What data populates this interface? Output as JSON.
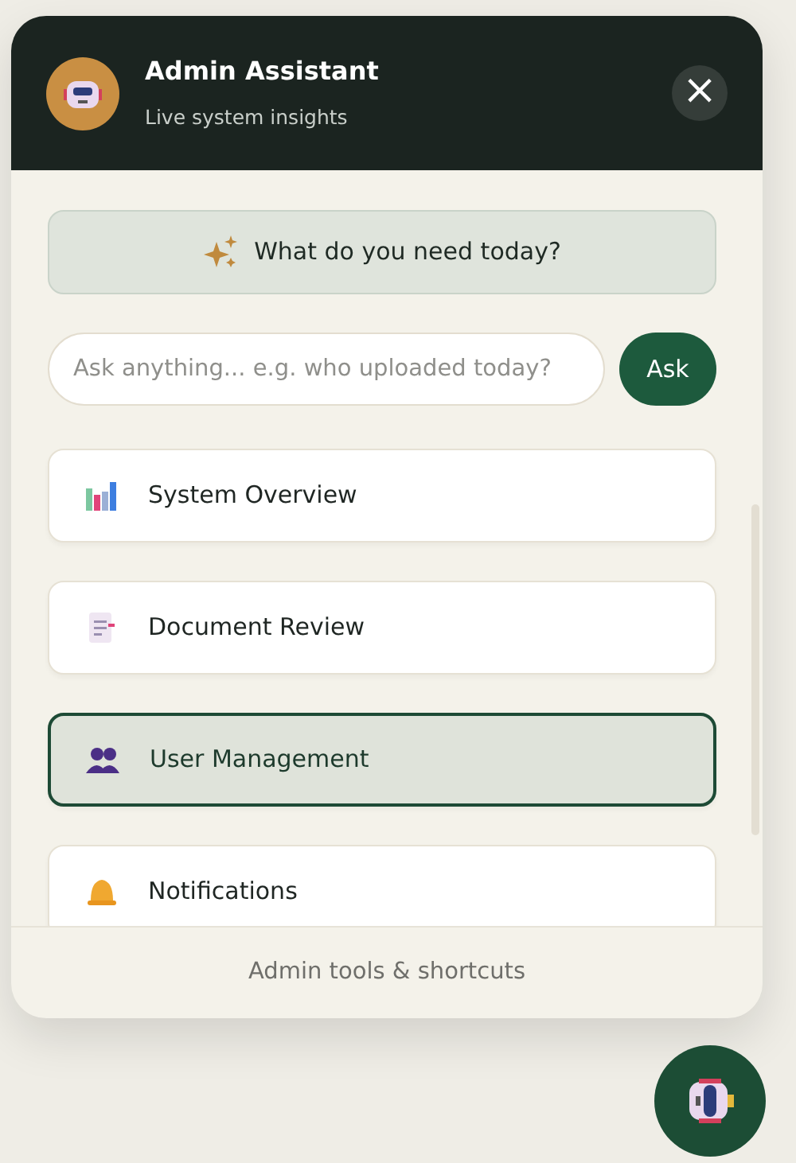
{
  "header": {
    "title": "Admin Assistant",
    "subtitle": "Live system insights",
    "close": "×"
  },
  "prompt": {
    "text": "What do you need today?"
  },
  "ask": {
    "placeholder": "Ask anything... e.g. who uploaded today?",
    "button": "Ask"
  },
  "menu": [
    {
      "label": "System Overview",
      "selected": false
    },
    {
      "label": "Document Review",
      "selected": false
    },
    {
      "label": "User Management",
      "selected": true
    },
    {
      "label": "Notifications",
      "selected": false
    }
  ],
  "footer": "Admin tools & shortcuts"
}
